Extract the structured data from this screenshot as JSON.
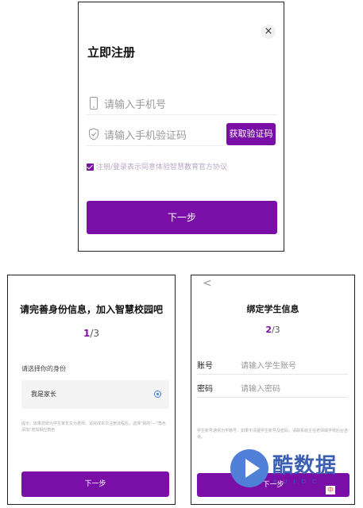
{
  "register": {
    "close_icon": "close-icon",
    "close_label": "×",
    "title": "立即注册",
    "phone_icon": "phone-icon",
    "phone_placeholder": "请输入手机号",
    "code_icon": "shield-icon",
    "code_placeholder": "请输入手机验证码",
    "get_code_label": "获取验证码",
    "agreement_text": "注册/登录表示同意体验智慧教育官方协议",
    "next_label": "下一步",
    "accent_color": "#7a0fa8"
  },
  "identity": {
    "title": "请完善身份信息，加入智慧校园吧",
    "step_current": "1",
    "step_total": "/3",
    "select_label": "请选择你的身份",
    "option_label": "我是家长",
    "hint": "提示：如果您即为学生家长又为老师，请完成本次注册流程后，选择\"我的\"—\"角色添加\"增加相应角色",
    "next_label": "下一步"
  },
  "bind": {
    "back_label": "<",
    "title": "绑定学生信息",
    "step_current": "2",
    "step_total": "/3",
    "account_label": "账号",
    "account_placeholder": "请输入学生账号",
    "password_label": "密码",
    "password_placeholder": "请输入密码",
    "hint": "学生账号通常为学籍号，如果不清楚学生账号及密码，请联系班主任老师或学校后台咨询。",
    "next_label": "下一步"
  },
  "watermark": {
    "brand": "酷数据",
    "subtext": "KUIDC",
    "chip": "中"
  }
}
